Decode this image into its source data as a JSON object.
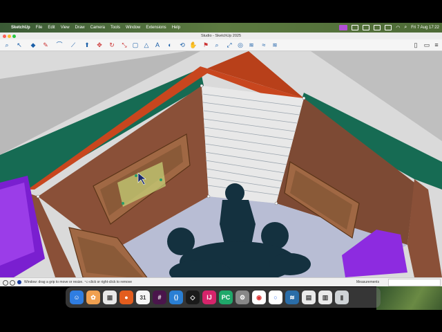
{
  "menubar": {
    "app": "SketchUp",
    "items": [
      "File",
      "Edit",
      "View",
      "Draw",
      "Camera",
      "Tools",
      "Window",
      "Extensions",
      "Help"
    ],
    "clock": "Fri 7 Aug 17:22"
  },
  "window": {
    "title": "Studio - SketchUp 2025"
  },
  "toolbar": {
    "tools": [
      "select",
      "eraser",
      "line",
      "pencil",
      "shape",
      "push-pull",
      "move",
      "rotate",
      "scale",
      "offset",
      "tape-measure",
      "text",
      "paint",
      "orbit",
      "pan",
      "zoom",
      "zoom-extents",
      "section",
      "styles",
      "layers",
      "components"
    ]
  },
  "statusbar": {
    "hint": "Window: drag a grip to move or resize. ⌥-click or right-click to remove",
    "measurements_label": "Measurements"
  },
  "dock": {
    "apps": [
      "Finder",
      "Launchpad",
      "Calendar app",
      "Firefox",
      "Calendar",
      "Slack",
      "VS Code",
      "Cursor",
      "IntelliJ",
      "PyCharm",
      "System Settings",
      "Chrome",
      "Signal",
      "Stats",
      "Preview",
      "Photos",
      "Trash"
    ],
    "calendar_day": "31"
  },
  "colors": {
    "accent": "#1a5fa8",
    "wall": "#8a5038",
    "trim": "#c8461e",
    "floor": "#b8bdd4",
    "silhouette": "#14313f"
  }
}
